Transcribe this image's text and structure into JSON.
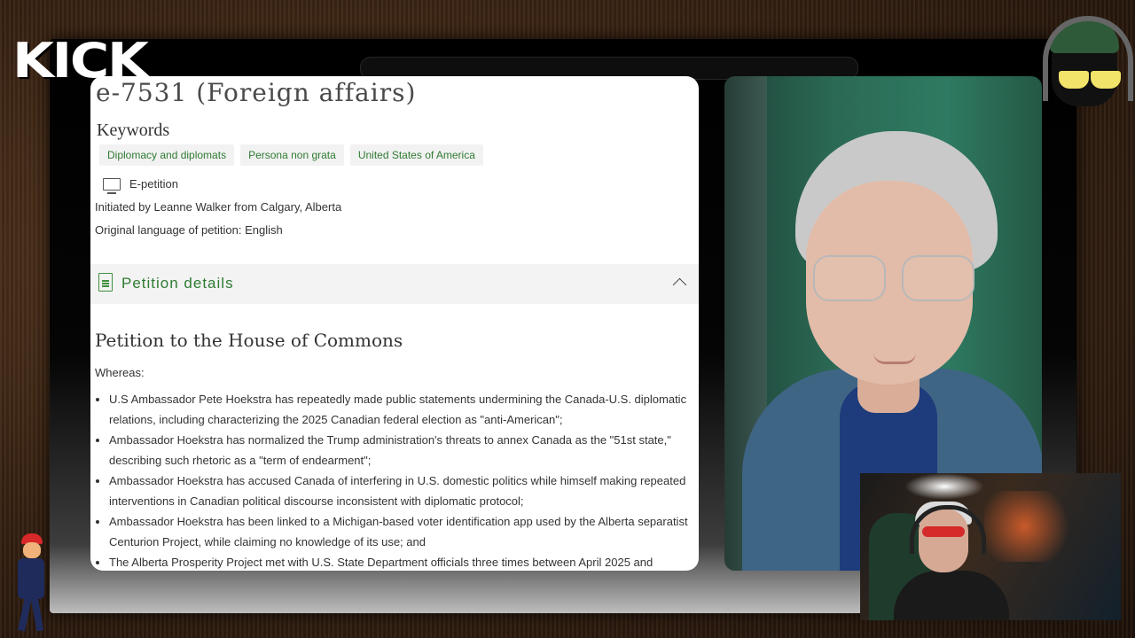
{
  "stream": {
    "logo_text": "KICK"
  },
  "document": {
    "title": "e-7531 (Foreign affairs)",
    "keywords_heading": "Keywords",
    "keywords": [
      "Diplomacy and diplomats",
      "Persona non grata",
      "United States of America"
    ],
    "type_label": "E-petition",
    "initiated_by": "Initiated by Leanne Walker from Calgary, Alberta",
    "original_language": "Original language of petition: English",
    "details_label": "Petition details",
    "petition_heading": "Petition to the House of Commons",
    "whereas": "Whereas:",
    "clauses": [
      "U.S Ambassador Pete Hoekstra has repeatedly made public statements undermining the Canada-U.S. diplomatic relations, including characterizing the 2025 Canadian federal election as \"anti-American\";",
      "Ambassador Hoekstra has normalized the Trump administration's threats to annex Canada as the \"51st state,\" describing such rhetoric as a \"term of endearment\";",
      "Ambassador Hoekstra has accused Canada of interfering in U.S. domestic politics while himself making repeated interventions in Canadian political discourse inconsistent with diplomatic protocol;",
      "Ambassador Hoekstra has been linked to a Michigan-based voter identification app used by the Alberta separatist Centurion Project, while claiming no knowledge of its use; and",
      "The Alberta Prosperity Project met with U.S. State Department officials three times between April 2025 and"
    ]
  },
  "colors": {
    "keyword_text": "#2f7b32",
    "details_bar": "#f3f3f3"
  }
}
